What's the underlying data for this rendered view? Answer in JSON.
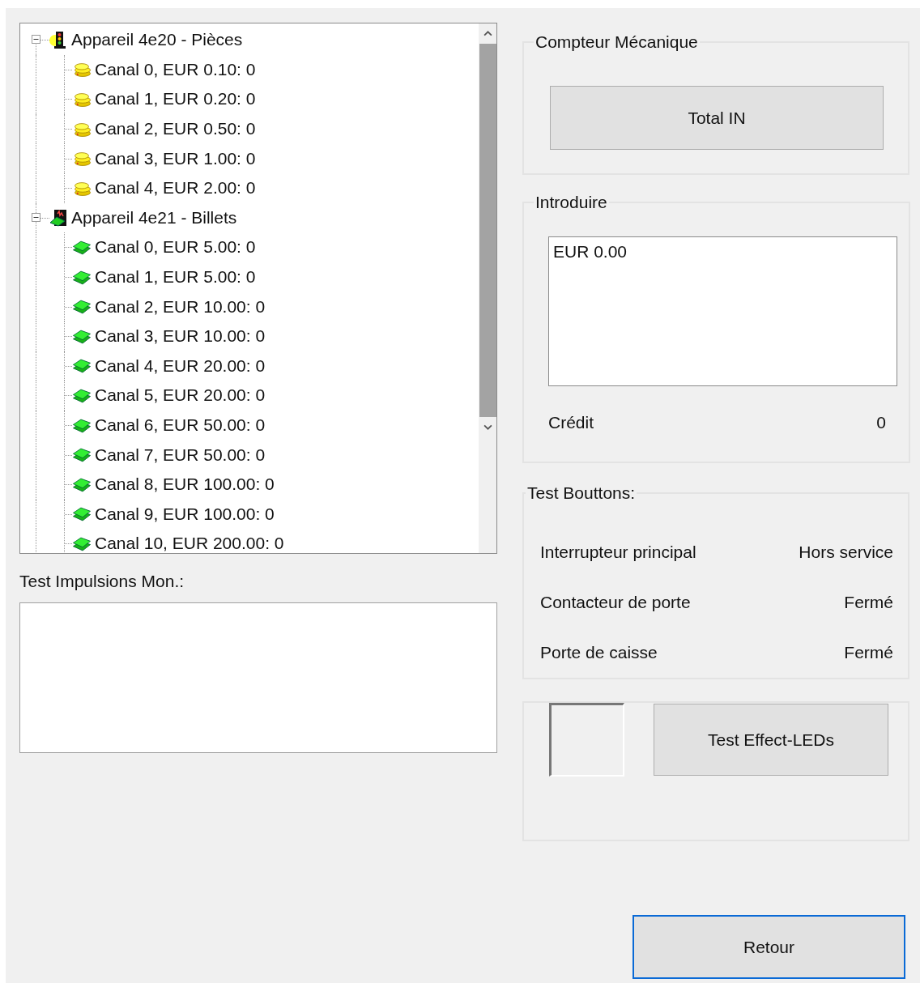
{
  "tree": [
    {
      "label": "Appareil 4e20 - Pièces",
      "kind": "coins",
      "expanded": true,
      "children": [
        {
          "label": "Canal 0, EUR 0.10: 0"
        },
        {
          "label": "Canal 1, EUR 0.20: 0"
        },
        {
          "label": "Canal 2, EUR 0.50: 0"
        },
        {
          "label": "Canal 3, EUR 1.00: 0"
        },
        {
          "label": "Canal 4, EUR 2.00: 0"
        }
      ]
    },
    {
      "label": "Appareil 4e21 - Billets",
      "kind": "notes",
      "expanded": true,
      "children": [
        {
          "label": "Canal 0, EUR 5.00: 0"
        },
        {
          "label": "Canal 1, EUR 5.00: 0"
        },
        {
          "label": "Canal 2, EUR 10.00: 0"
        },
        {
          "label": "Canal 3, EUR 10.00: 0"
        },
        {
          "label": "Canal 4, EUR 20.00: 0"
        },
        {
          "label": "Canal 5, EUR 20.00: 0"
        },
        {
          "label": "Canal 6, EUR 50.00: 0"
        },
        {
          "label": "Canal 7, EUR 50.00: 0"
        },
        {
          "label": "Canal 8, EUR 100.00: 0"
        },
        {
          "label": "Canal 9, EUR 100.00: 0"
        },
        {
          "label": "Canal 10, EUR 200.00: 0"
        }
      ]
    }
  ],
  "pulse_test": {
    "label": "Test Impulsions Mon.:"
  },
  "counter": {
    "legend": "Compteur Mécanique",
    "button": "Total IN"
  },
  "insert": {
    "legend": "Introduire",
    "value": "EUR 0.00",
    "credit_label": "Crédit",
    "credit_value": "0"
  },
  "button_test": {
    "legend": "Test Bouttons:",
    "rows": [
      {
        "label": "Interrupteur principal",
        "status": "Hors service"
      },
      {
        "label": "Contacteur de porte",
        "status": "Fermé"
      },
      {
        "label": "Porte de caisse",
        "status": "Fermé"
      }
    ]
  },
  "leds": {
    "button": "Test Effect-LEDs"
  },
  "back_button": {
    "label": "Retour",
    "focused": true
  }
}
